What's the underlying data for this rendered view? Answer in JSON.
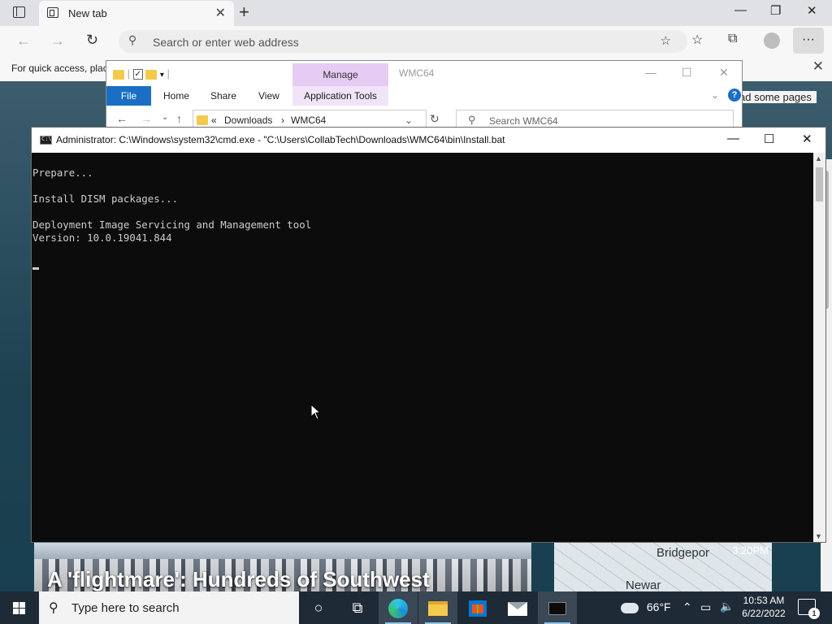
{
  "browser": {
    "tab_title": "New tab",
    "address_placeholder": "Search or enter web address",
    "favorites_bar_text": "For quick access, plac",
    "page_note": "ad some pages",
    "news": {
      "headline": "A 'flightmare': Hundreds of Southwest",
      "map_label_1": "Bridgepor",
      "map_label_2": "Newar",
      "map_time": "3:20PM"
    }
  },
  "explorer": {
    "title": "WMC64",
    "manage_tab": "Manage",
    "ribbon": {
      "file": "File",
      "home": "Home",
      "share": "Share",
      "view": "View",
      "app_tools": "Application Tools"
    },
    "path": {
      "prefix": "«",
      "crumb_1": "Downloads",
      "separator": "›",
      "crumb_2": "WMC64"
    },
    "search_placeholder": "Search WMC64"
  },
  "cmd": {
    "title": "Administrator: C:\\Windows\\system32\\cmd.exe - \"C:\\Users\\CollabTech\\Downloads\\WMC64\\bin\\Install.bat",
    "lines": [
      "Prepare...",
      "",
      "Install DISM packages...",
      "",
      "Deployment Image Servicing and Management tool",
      "Version: 10.0.19041.844",
      ""
    ]
  },
  "taskbar": {
    "search_text": "Type here to search",
    "weather": "66°F",
    "time": "10:53 AM",
    "date": "6/22/2022",
    "notification_count": "1"
  },
  "colors": {
    "console_bg": "#0c0c0c",
    "console_text": "#cccccc",
    "taskbar": "#1e2a36",
    "manage_tab": "#e6cbf5",
    "file_tab": "#1a6fc4"
  }
}
